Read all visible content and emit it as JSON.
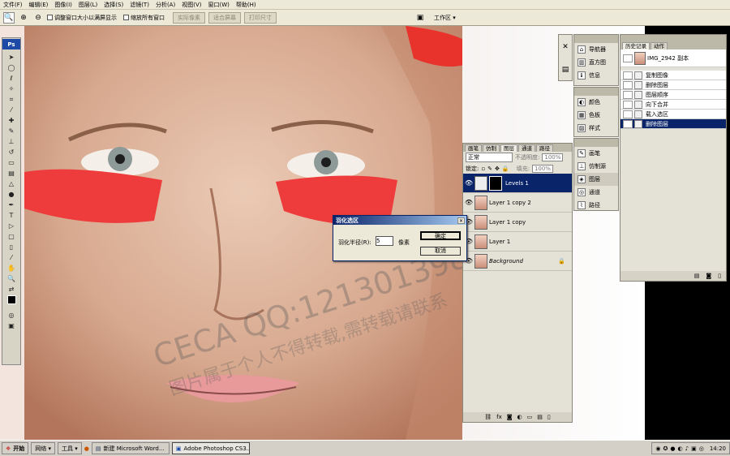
{
  "menu": [
    "文件(F)",
    "编辑(E)",
    "图像(I)",
    "图层(L)",
    "选择(S)",
    "滤镜(T)",
    "分析(A)",
    "视图(V)",
    "窗口(W)",
    "帮助(H)"
  ],
  "options": {
    "resize_label": "调整窗口大小以满屏显示",
    "zoom_all_label": "缩放所有窗口",
    "actual_pixels": "实际像素",
    "fit_screen": "适合屏幕",
    "print_size": "打印尺寸",
    "workspace": "工作区 ▾"
  },
  "toolbox": {
    "logo": "Ps"
  },
  "navigator_panel": {
    "items": [
      "导航器",
      "直方图",
      "信息"
    ]
  },
  "color_panel": {
    "items": [
      "颜色",
      "色板",
      "样式"
    ]
  },
  "brush_panel": {
    "items": [
      "画笔",
      "仿制源",
      "图层",
      "通道",
      "路径"
    ]
  },
  "history": {
    "tabs": [
      "历史记录",
      "动作"
    ],
    "snapshot": "IMG_2942 副本",
    "steps": [
      "复制图像",
      "删除图层",
      "图层顺序",
      "向下合并",
      "载入选区",
      "删除图层"
    ],
    "selected_index": 5
  },
  "layers": {
    "tabs": [
      "画笔",
      "仿制",
      "图层",
      "通道",
      "路径"
    ],
    "blend_mode": "正常",
    "opacity_label": "不透明度:",
    "opacity": "100%",
    "lock_label": "锁定:",
    "fill_label": "填充:",
    "fill": "100%",
    "items": [
      {
        "name": "Levels 1",
        "selected": true,
        "adjust": true
      },
      {
        "name": "Layer 1 copy 2",
        "selected": false,
        "adjust": false
      },
      {
        "name": "Layer 1 copy",
        "selected": false,
        "adjust": false
      },
      {
        "name": "Layer 1",
        "selected": false,
        "adjust": false
      },
      {
        "name": "Background",
        "selected": false,
        "adjust": false
      }
    ]
  },
  "dialog": {
    "title": "羽化选区",
    "radius_label": "羽化半径(R):",
    "radius_value": "5",
    "unit": "像素",
    "ok": "确定",
    "cancel": "取消"
  },
  "watermark": {
    "line1": "CECA QQ:1213013983",
    "line2": "图片属于个人不得转载,需转载请联系"
  },
  "taskbar": {
    "start": "开始",
    "network": "网络 ▾",
    "tools": "工具 ▾",
    "word": "新建 Microsoft Word...",
    "photoshop": "Adobe Photoshop CS3...",
    "clock": "14:20"
  },
  "colors": {
    "title_bar": "#0a246a",
    "lash_red": "#ee3b3b",
    "panel_bg": "#e4e1d6"
  }
}
